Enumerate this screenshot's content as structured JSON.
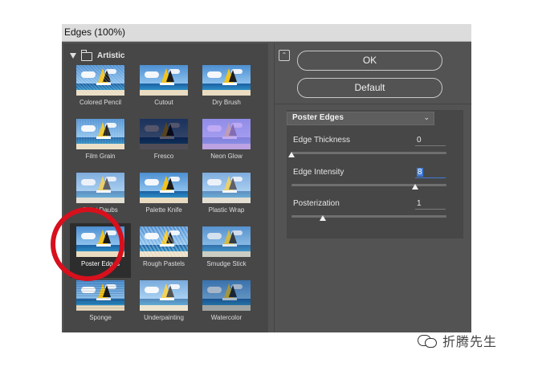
{
  "window": {
    "title": "Edges (100%)"
  },
  "gallery": {
    "category": "Artistic",
    "filters": [
      {
        "label": "Colored Pencil",
        "fx": "pencil"
      },
      {
        "label": "Cutout",
        "fx": "none"
      },
      {
        "label": "Dry Brush",
        "fx": "none"
      },
      {
        "label": "Film Grain",
        "fx": "grain"
      },
      {
        "label": "Fresco",
        "fx": "fresco"
      },
      {
        "label": "Neon Glow",
        "fx": "neon"
      },
      {
        "label": "Paint Daubs",
        "fx": "paint"
      },
      {
        "label": "Palette Knife",
        "fx": "none"
      },
      {
        "label": "Plastic Wrap",
        "fx": "paint"
      },
      {
        "label": "Poster Edges",
        "fx": "none",
        "selected": true
      },
      {
        "label": "Rough Pastels",
        "fx": "pastel"
      },
      {
        "label": "Smudge Stick",
        "fx": "smudge"
      },
      {
        "label": "Sponge",
        "fx": "sponge"
      },
      {
        "label": "Underpainting",
        "fx": "under"
      },
      {
        "label": "Watercolor",
        "fx": "water"
      }
    ]
  },
  "buttons": {
    "ok": "OK",
    "default": "Default"
  },
  "settings": {
    "filter_select": "Poster Edges",
    "params": [
      {
        "label": "Edge Thickness",
        "value": "0",
        "slider_fraction": 0.0
      },
      {
        "label": "Edge Intensity",
        "value": "8",
        "slider_fraction": 0.8
      },
      {
        "label": "Posterization",
        "value": "1",
        "slider_fraction": 0.2
      }
    ]
  },
  "watermark": {
    "text": "折腾先生",
    "icon": "wechat-icon"
  },
  "colors": {
    "highlight_circle": "#d8101d",
    "panel": "#535353",
    "focus": "#3d7bd6"
  }
}
